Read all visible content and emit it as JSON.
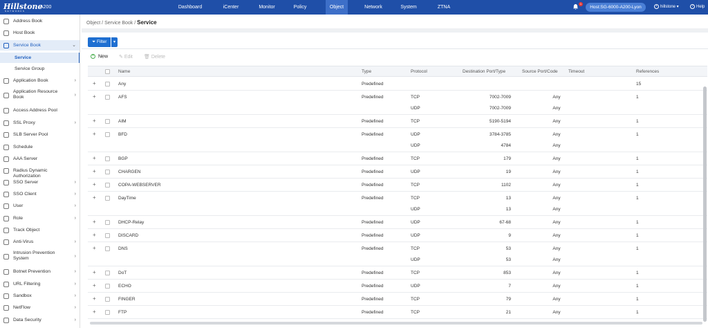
{
  "topbar": {
    "brand": "Hillstone",
    "brand_sub": "NETWORKS",
    "model": "A200",
    "nav": [
      {
        "label": "Dashboard"
      },
      {
        "label": "iCenter"
      },
      {
        "label": "Monitor"
      },
      {
        "label": "Policy"
      },
      {
        "label": "Object"
      },
      {
        "label": "Network"
      },
      {
        "label": "System"
      },
      {
        "label": "ZTNA"
      }
    ],
    "active_nav": "Object",
    "notification_count": "1",
    "host": "Host:SG-6000-A200-Lyon",
    "user": "hillstone",
    "help": "Help"
  },
  "sidebar": {
    "items": [
      {
        "label": "Address Book",
        "icon": "address-book-icon",
        "chevron": false
      },
      {
        "label": "Host Book",
        "icon": "host-book-icon",
        "chevron": false
      },
      {
        "label": "Service Book",
        "icon": "service-book-icon",
        "chevron": true,
        "expanded": true
      },
      {
        "label": "Service",
        "sub": true,
        "current": true
      },
      {
        "label": "Service Group",
        "sub": true
      },
      {
        "label": "Application Book",
        "icon": "application-book-icon",
        "chevron": true
      },
      {
        "label": "Application Resource Book",
        "icon": "application-resource-icon",
        "chevron": true,
        "two_line": true
      },
      {
        "label": "Access Address Pool",
        "icon": "access-pool-icon",
        "chevron": false
      },
      {
        "label": "SSL Proxy",
        "icon": "ssl-proxy-icon",
        "chevron": true
      },
      {
        "label": "SLB Server Pool",
        "icon": "slb-pool-icon",
        "chevron": false
      },
      {
        "label": "Schedule",
        "icon": "schedule-icon",
        "chevron": false
      },
      {
        "label": "AAA Server",
        "icon": "aaa-server-icon",
        "chevron": false
      },
      {
        "label": "Radius Dynamic Authorization",
        "icon": "radius-icon",
        "chevron": false
      },
      {
        "label": "SSO Server",
        "icon": "sso-server-icon",
        "chevron": true
      },
      {
        "label": "SSO Client",
        "icon": "sso-client-icon",
        "chevron": true
      },
      {
        "label": "User",
        "icon": "user-icon",
        "chevron": true
      },
      {
        "label": "Role",
        "icon": "role-icon",
        "chevron": true
      },
      {
        "label": "Track Object",
        "icon": "track-object-icon",
        "chevron": false
      },
      {
        "label": "Anti-Virus",
        "icon": "anti-virus-icon",
        "chevron": true
      },
      {
        "label": "Intrusion Prevention System",
        "icon": "ips-icon",
        "chevron": true,
        "two_line": true
      },
      {
        "label": "Botnet Prevention",
        "icon": "botnet-icon",
        "chevron": true
      },
      {
        "label": "URL Filtering",
        "icon": "url-filter-icon",
        "chevron": true
      },
      {
        "label": "Sandbox",
        "icon": "sandbox-icon",
        "chevron": true
      },
      {
        "label": "NetFlow",
        "icon": "netflow-icon",
        "chevron": true
      },
      {
        "label": "Data Security",
        "icon": "data-security-icon",
        "chevron": true
      }
    ]
  },
  "breadcrumb": {
    "path": "Object / Service Book / ",
    "current": "Service"
  },
  "toolbar": {
    "filter": "Filter",
    "new": "New",
    "edit": "Edit",
    "delete": "Delete"
  },
  "table": {
    "columns": [
      "Name",
      "Type",
      "Protocol",
      "Destination Port/Type",
      "Source Port/Code",
      "Timeout",
      "References"
    ],
    "rows": [
      {
        "name": "Any",
        "type": "Predefined",
        "entries": [
          {
            "protocol": "",
            "dest": "",
            "src": ""
          }
        ],
        "timeout": "",
        "refs": "15"
      },
      {
        "name": "AFS",
        "type": "Predefined",
        "entries": [
          {
            "protocol": "TCP",
            "dest": "7002-7009",
            "src": "Any"
          },
          {
            "protocol": "UDP",
            "dest": "7002-7009",
            "src": "Any"
          }
        ],
        "timeout": "",
        "refs": "1"
      },
      {
        "name": "AIM",
        "type": "Predefined",
        "entries": [
          {
            "protocol": "TCP",
            "dest": "5190-5194",
            "src": "Any"
          }
        ],
        "timeout": "",
        "refs": "1"
      },
      {
        "name": "BFD",
        "type": "Predefined",
        "entries": [
          {
            "protocol": "UDP",
            "dest": "3784-3785",
            "src": "Any"
          },
          {
            "protocol": "UDP",
            "dest": "4784",
            "src": "Any"
          }
        ],
        "timeout": "",
        "refs": "1"
      },
      {
        "name": "BGP",
        "type": "Predefined",
        "entries": [
          {
            "protocol": "TCP",
            "dest": "179",
            "src": "Any"
          }
        ],
        "timeout": "",
        "refs": "1"
      },
      {
        "name": "CHARGEN",
        "type": "Predefined",
        "entries": [
          {
            "protocol": "UDP",
            "dest": "19",
            "src": "Any"
          }
        ],
        "timeout": "",
        "refs": "1"
      },
      {
        "name": "COPA-WEBSERVER",
        "type": "Predefined",
        "entries": [
          {
            "protocol": "TCP",
            "dest": "1102",
            "src": "Any"
          }
        ],
        "timeout": "",
        "refs": "1"
      },
      {
        "name": "DayTime",
        "type": "Predefined",
        "entries": [
          {
            "protocol": "TCP",
            "dest": "13",
            "src": "Any"
          },
          {
            "protocol": "UDP",
            "dest": "13",
            "src": "Any"
          }
        ],
        "timeout": "",
        "refs": "1"
      },
      {
        "name": "DHCP-Relay",
        "type": "Predefined",
        "entries": [
          {
            "protocol": "UDP",
            "dest": "67-68",
            "src": "Any"
          }
        ],
        "timeout": "",
        "refs": "1"
      },
      {
        "name": "DISCARD",
        "type": "Predefined",
        "entries": [
          {
            "protocol": "UDP",
            "dest": "9",
            "src": "Any"
          }
        ],
        "timeout": "",
        "refs": "1"
      },
      {
        "name": "DNS",
        "type": "Predefined",
        "entries": [
          {
            "protocol": "TCP",
            "dest": "53",
            "src": "Any"
          },
          {
            "protocol": "UDP",
            "dest": "53",
            "src": "Any"
          }
        ],
        "timeout": "",
        "refs": "1"
      },
      {
        "name": "DoT",
        "type": "Predefined",
        "entries": [
          {
            "protocol": "TCP",
            "dest": "853",
            "src": "Any"
          }
        ],
        "timeout": "",
        "refs": "1"
      },
      {
        "name": "ECHO",
        "type": "Predefined",
        "entries": [
          {
            "protocol": "UDP",
            "dest": "7",
            "src": "Any"
          }
        ],
        "timeout": "",
        "refs": "1"
      },
      {
        "name": "FINGER",
        "type": "Predefined",
        "entries": [
          {
            "protocol": "TCP",
            "dest": "79",
            "src": "Any"
          }
        ],
        "timeout": "",
        "refs": "1"
      },
      {
        "name": "FTP",
        "type": "Predefined",
        "entries": [
          {
            "protocol": "TCP",
            "dest": "21",
            "src": "Any"
          }
        ],
        "timeout": "",
        "refs": "1"
      }
    ]
  },
  "colors": {
    "topbar": "#1f4fa8",
    "accent": "#1f6fd1",
    "active_bg": "#e3ecf8"
  }
}
